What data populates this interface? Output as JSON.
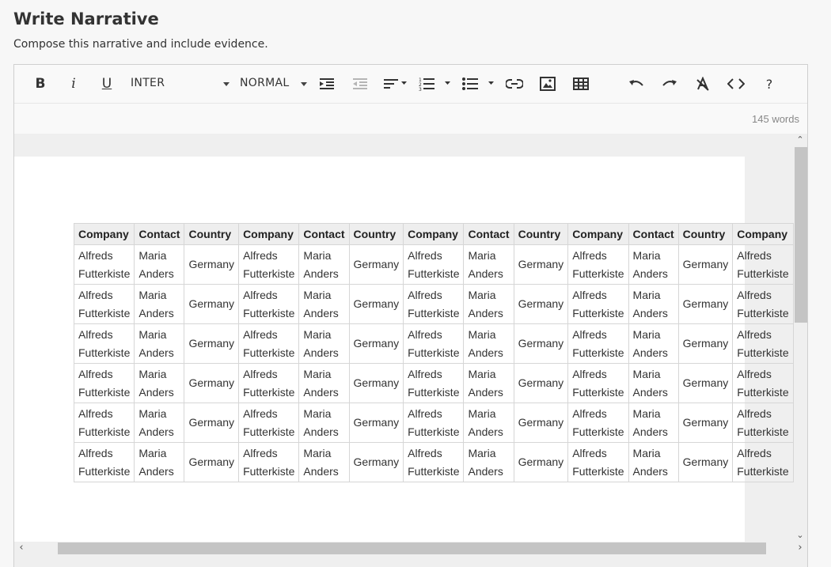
{
  "page": {
    "title": "Write Narrative",
    "subtitle": "Compose this narrative and include evidence."
  },
  "toolbar": {
    "bold_label": "B",
    "italic_label": "i",
    "underline_label": "U",
    "font_select": "INTER",
    "size_select": "NORMAL",
    "help_label": "?",
    "icons": [
      "bold-icon",
      "italic-icon",
      "underline-icon",
      "indent-icon",
      "outdent-icon",
      "align-icon",
      "numbered-list-icon",
      "bullet-list-icon",
      "link-icon",
      "image-icon",
      "table-icon",
      "undo-icon",
      "redo-icon",
      "clear-format-icon",
      "code-icon",
      "help-icon"
    ]
  },
  "status": {
    "word_count": "145 words"
  },
  "table": {
    "headers": [
      "Company",
      "Contact",
      "Country",
      "Company",
      "Contact",
      "Country",
      "Company",
      "Contact",
      "Country",
      "Company",
      "Contact",
      "Country",
      "Company"
    ],
    "rows": [
      [
        [
          "Alfreds",
          "Futterkiste"
        ],
        [
          "Maria",
          "Anders"
        ],
        [
          "Germany"
        ],
        [
          "Alfreds",
          "Futterkiste"
        ],
        [
          "Maria",
          "Anders"
        ],
        [
          "Germany"
        ],
        [
          "Alfreds",
          "Futterkiste"
        ],
        [
          "Maria",
          "Anders"
        ],
        [
          "Germany"
        ],
        [
          "Alfreds",
          "Futterkiste"
        ],
        [
          "Maria",
          "Anders"
        ],
        [
          "Germany"
        ],
        [
          "Alfreds",
          "Futterkiste"
        ]
      ],
      [
        [
          "Alfreds",
          "Futterkiste"
        ],
        [
          "Maria",
          "Anders"
        ],
        [
          "Germany"
        ],
        [
          "Alfreds",
          "Futterkiste"
        ],
        [
          "Maria",
          "Anders"
        ],
        [
          "Germany"
        ],
        [
          "Alfreds",
          "Futterkiste"
        ],
        [
          "Maria",
          "Anders"
        ],
        [
          "Germany"
        ],
        [
          "Alfreds",
          "Futterkiste"
        ],
        [
          "Maria",
          "Anders"
        ],
        [
          "Germany"
        ],
        [
          "Alfreds",
          "Futterkiste"
        ]
      ],
      [
        [
          "Alfreds",
          "Futterkiste"
        ],
        [
          "Maria",
          "Anders"
        ],
        [
          "Germany"
        ],
        [
          "Alfreds",
          "Futterkiste"
        ],
        [
          "Maria",
          "Anders"
        ],
        [
          "Germany"
        ],
        [
          "Alfreds",
          "Futterkiste"
        ],
        [
          "Maria",
          "Anders"
        ],
        [
          "Germany"
        ],
        [
          "Alfreds",
          "Futterkiste"
        ],
        [
          "Maria",
          "Anders"
        ],
        [
          "Germany"
        ],
        [
          "Alfreds",
          "Futterkiste"
        ]
      ],
      [
        [
          "Alfreds",
          "Futterkiste"
        ],
        [
          "Maria",
          "Anders"
        ],
        [
          "Germany"
        ],
        [
          "Alfreds",
          "Futterkiste"
        ],
        [
          "Maria",
          "Anders"
        ],
        [
          "Germany"
        ],
        [
          "Alfreds",
          "Futterkiste"
        ],
        [
          "Maria",
          "Anders"
        ],
        [
          "Germany"
        ],
        [
          "Alfreds",
          "Futterkiste"
        ],
        [
          "Maria",
          "Anders"
        ],
        [
          "Germany"
        ],
        [
          "Alfreds",
          "Futterkiste"
        ]
      ],
      [
        [
          "Alfreds",
          "Futterkiste"
        ],
        [
          "Maria",
          "Anders"
        ],
        [
          "Germany"
        ],
        [
          "Alfreds",
          "Futterkiste"
        ],
        [
          "Maria",
          "Anders"
        ],
        [
          "Germany"
        ],
        [
          "Alfreds",
          "Futterkiste"
        ],
        [
          "Maria",
          "Anders"
        ],
        [
          "Germany"
        ],
        [
          "Alfreds",
          "Futterkiste"
        ],
        [
          "Maria",
          "Anders"
        ],
        [
          "Germany"
        ],
        [
          "Alfreds",
          "Futterkiste"
        ]
      ],
      [
        [
          "Alfreds",
          "Futterkiste"
        ],
        [
          "Maria",
          "Anders"
        ],
        [
          "Germany"
        ],
        [
          "Alfreds",
          "Futterkiste"
        ],
        [
          "Maria",
          "Anders"
        ],
        [
          "Germany"
        ],
        [
          "Alfreds",
          "Futterkiste"
        ],
        [
          "Maria",
          "Anders"
        ],
        [
          "Germany"
        ],
        [
          "Alfreds",
          "Futterkiste"
        ],
        [
          "Maria",
          "Anders"
        ],
        [
          "Germany"
        ],
        [
          "Alfreds",
          "Futterkiste"
        ]
      ]
    ]
  },
  "colors": {
    "background": "#f7f7f7",
    "border": "#cfcfcf",
    "header_cell": "#eeeeee",
    "scrollbar_thumb": "#c4c4c4"
  }
}
